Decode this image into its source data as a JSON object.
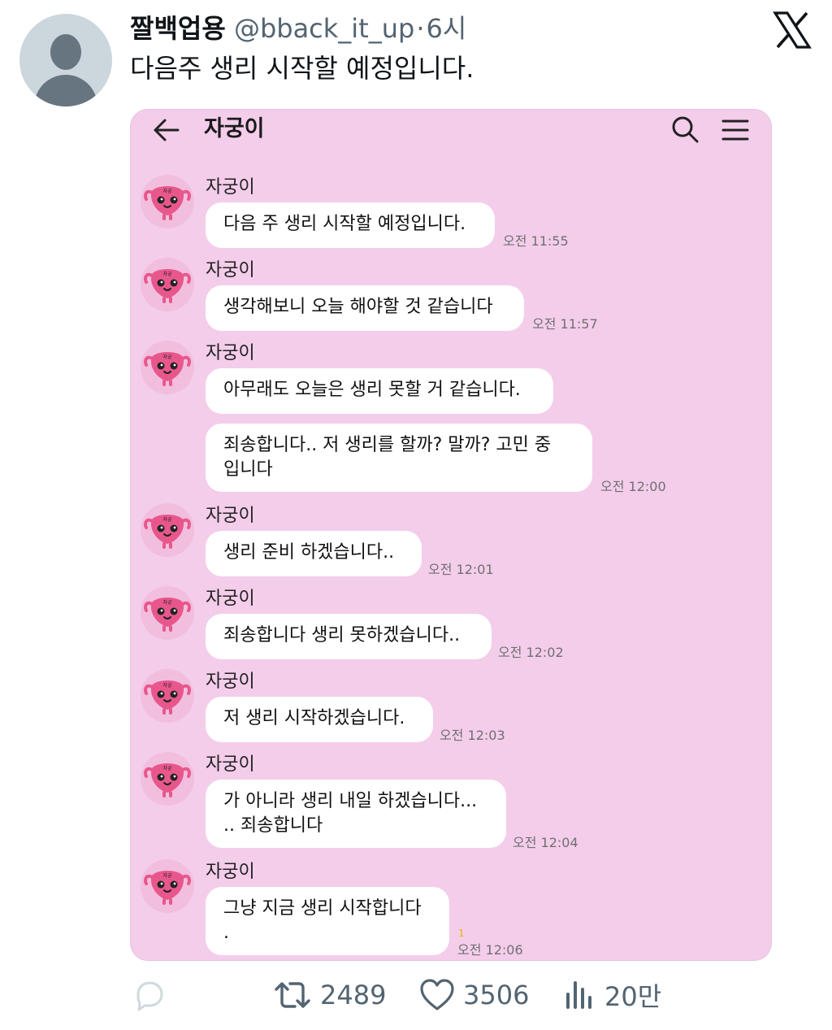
{
  "tweet": {
    "display_name": "짤백업용",
    "handle": "@bback_it_up",
    "separator": "·",
    "time": "6시",
    "text": "다음주 생리 시작할 예정입니다."
  },
  "chat": {
    "title": "자궁이",
    "messages": [
      {
        "sender": "자궁이",
        "bubbles": [
          "다음 주 생리 시작할 예정입니다."
        ],
        "time": "오전 11:55"
      },
      {
        "sender": "자궁이",
        "bubbles": [
          "생각해보니 오늘 해야할 것 같습니다"
        ],
        "time": "오전 11:57"
      },
      {
        "sender": "자궁이",
        "bubbles": [
          "아무래도 오늘은 생리 못할 거 같습니다.",
          "죄송합니다.. 저 생리를 할까? 말까? 고민 중\n입니다"
        ],
        "time": "오전 12:00"
      },
      {
        "sender": "자궁이",
        "bubbles": [
          "생리 준비 하겠습니다.."
        ],
        "time": "오전 12:01"
      },
      {
        "sender": "자궁이",
        "bubbles": [
          "죄송합니다 생리 못하겠습니다.."
        ],
        "time": "오전 12:02"
      },
      {
        "sender": "자궁이",
        "bubbles": [
          "저 생리 시작하겠습니다."
        ],
        "time": "오전 12:03"
      },
      {
        "sender": "자궁이",
        "bubbles": [
          "가 아니라 생리 내일 하겠습니다...\n.. 죄송합니다"
        ],
        "time": "오전 12:04"
      },
      {
        "sender": "자궁이",
        "bubbles": [
          "그냥 지금 생리 시작합니다\n."
        ],
        "time": "오전 12:06",
        "unread": "1"
      }
    ]
  },
  "actions": {
    "reply_count": "",
    "retweets": "2489",
    "likes": "3506",
    "views": "20만"
  },
  "icons": {
    "logo": "x-logo-icon",
    "back": "arrow-left-icon",
    "search": "search-icon",
    "menu": "hamburger-menu-icon",
    "reply": "reply-icon",
    "retweet": "retweet-icon",
    "like": "heart-icon",
    "views": "views-chart-icon"
  },
  "colors": {
    "chat_background": "#f4cdeb",
    "bubble": "#ffffff",
    "secondary_text": "#536471",
    "uterus_character": "#e8578c"
  }
}
